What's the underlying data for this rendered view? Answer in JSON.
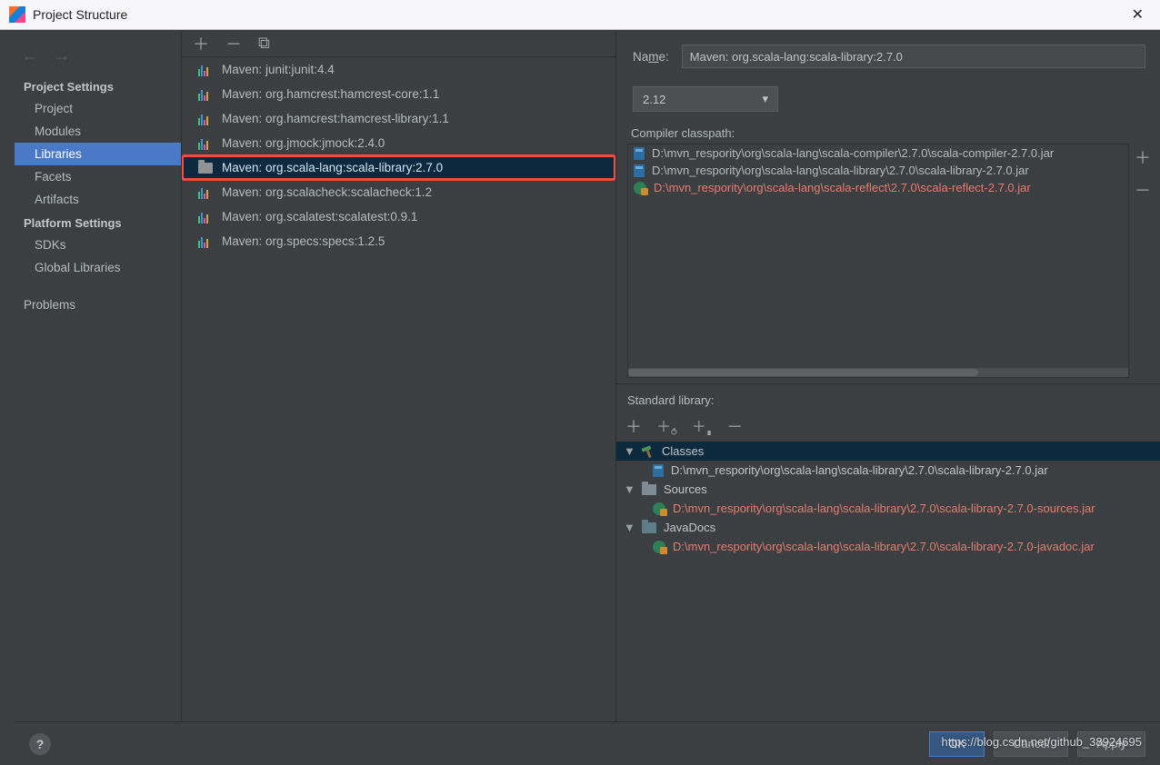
{
  "window": {
    "title": "Project Structure"
  },
  "sidebar": {
    "headings": {
      "project_settings": "Project Settings",
      "platform_settings": "Platform Settings"
    },
    "items": {
      "project": "Project",
      "modules": "Modules",
      "libraries": "Libraries",
      "facets": "Facets",
      "artifacts": "Artifacts",
      "sdks": "SDKs",
      "global_libraries": "Global Libraries",
      "problems": "Problems"
    }
  },
  "libraries": [
    {
      "label": "Maven: junit:junit:4.4",
      "icon": "bars",
      "selected": false,
      "highlighted": false
    },
    {
      "label": "Maven: org.hamcrest:hamcrest-core:1.1",
      "icon": "bars",
      "selected": false,
      "highlighted": false
    },
    {
      "label": "Maven: org.hamcrest:hamcrest-library:1.1",
      "icon": "bars",
      "selected": false,
      "highlighted": false
    },
    {
      "label": "Maven: org.jmock:jmock:2.4.0",
      "icon": "bars",
      "selected": false,
      "highlighted": false
    },
    {
      "label": "Maven: org.scala-lang:scala-library:2.7.0",
      "icon": "folder",
      "selected": true,
      "highlighted": true
    },
    {
      "label": "Maven: org.scalacheck:scalacheck:1.2",
      "icon": "bars",
      "selected": false,
      "highlighted": false
    },
    {
      "label": "Maven: org.scalatest:scalatest:0.9.1",
      "icon": "bars",
      "selected": false,
      "highlighted": false
    },
    {
      "label": "Maven: org.specs:specs:1.2.5",
      "icon": "bars",
      "selected": false,
      "highlighted": false
    }
  ],
  "detail": {
    "name_label_pre": "Na",
    "name_label_u": "m",
    "name_label_post": "e:",
    "name_value": "Maven: org.scala-lang:scala-library:2.7.0",
    "version": "2.12",
    "compiler_classpath_label": "Compiler classpath:",
    "classpath": [
      {
        "path": "D:\\mvn_respority\\org\\scala-lang\\scala-compiler\\2.7.0\\scala-compiler-2.7.0.jar",
        "red": false,
        "icon": "jar"
      },
      {
        "path": "D:\\mvn_respority\\org\\scala-lang\\scala-library\\2.7.0\\scala-library-2.7.0.jar",
        "red": false,
        "icon": "jar"
      },
      {
        "path": "D:\\mvn_respority\\org\\scala-lang\\scala-reflect\\2.7.0\\scala-reflect-2.7.0.jar",
        "red": true,
        "icon": "globe"
      }
    ],
    "standard_library_label": "Standard library:",
    "tree": {
      "classes": {
        "label": "Classes",
        "child": {
          "path": "D:\\mvn_respority\\org\\scala-lang\\scala-library\\2.7.0\\scala-library-2.7.0.jar",
          "red": false,
          "icon": "jar"
        }
      },
      "sources": {
        "label": "Sources",
        "child": {
          "path": "D:\\mvn_respority\\org\\scala-lang\\scala-library\\2.7.0\\scala-library-2.7.0-sources.jar",
          "red": true,
          "icon": "globe"
        }
      },
      "javadocs": {
        "label": "JavaDocs",
        "child": {
          "path": "D:\\mvn_respority\\org\\scala-lang\\scala-library\\2.7.0\\scala-library-2.7.0-javadoc.jar",
          "red": true,
          "icon": "globe"
        }
      }
    }
  },
  "buttons": {
    "ok": "OK",
    "cancel": "Cancel",
    "apply": "Apply"
  },
  "watermark": "https://blog.csdn.net/github_38924695"
}
